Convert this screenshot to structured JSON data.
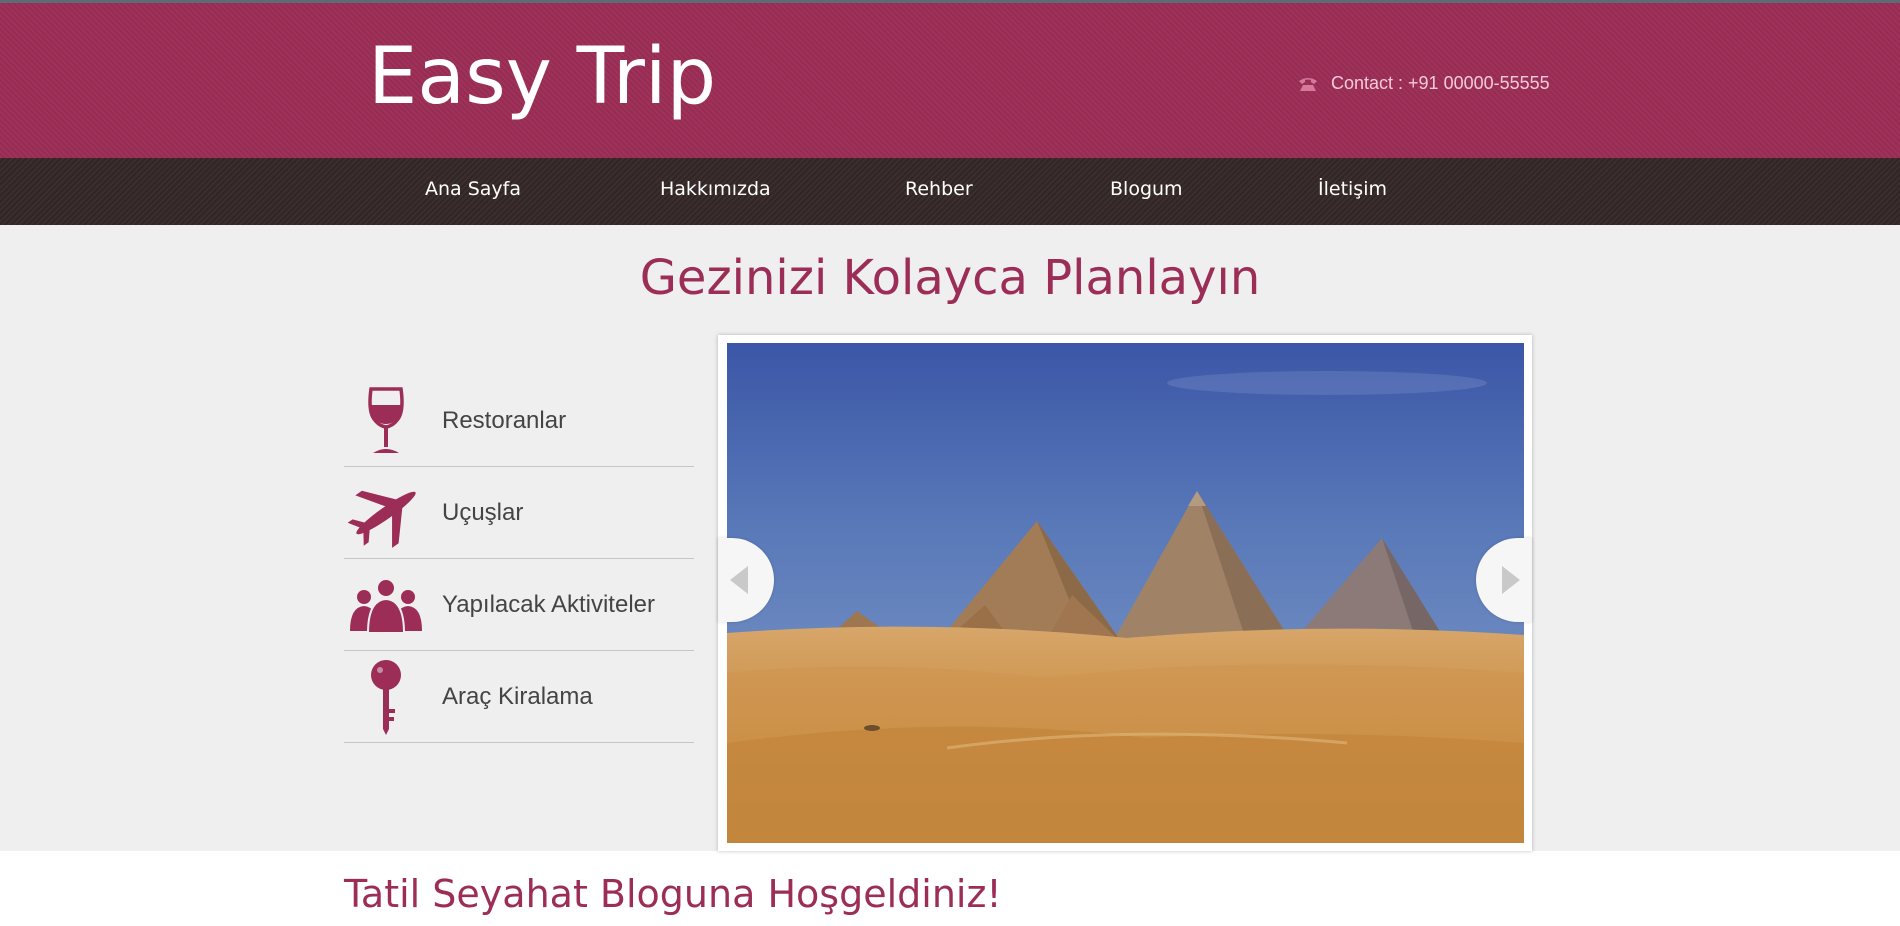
{
  "site": {
    "logo": "Easy Trip",
    "contact": "Contact : +91 00000-55555"
  },
  "nav": {
    "items": [
      "Ana Sayfa",
      "Hakkımızda",
      "Rehber",
      "Blogum",
      "İletişim"
    ]
  },
  "main": {
    "title": "Gezinizi Kolayca Planlayın",
    "features": [
      {
        "label": "Restoranlar",
        "icon": "wine-glass-icon"
      },
      {
        "label": "Uçuşlar",
        "icon": "airplane-icon"
      },
      {
        "label": "Yapılacak Aktiviteler",
        "icon": "people-group-icon"
      },
      {
        "label": "Araç Kiralama",
        "icon": "key-icon"
      }
    ],
    "slider": {
      "image": "pyramids-desert-photo"
    }
  },
  "welcome": {
    "title": "Tatil Seyahat Bloguna Hoşgeldiniz!"
  },
  "colors": {
    "brand": "#9c2d56",
    "nav_bg": "#342727",
    "main_bg": "#efefef",
    "contact_text": "#f6c9da"
  }
}
